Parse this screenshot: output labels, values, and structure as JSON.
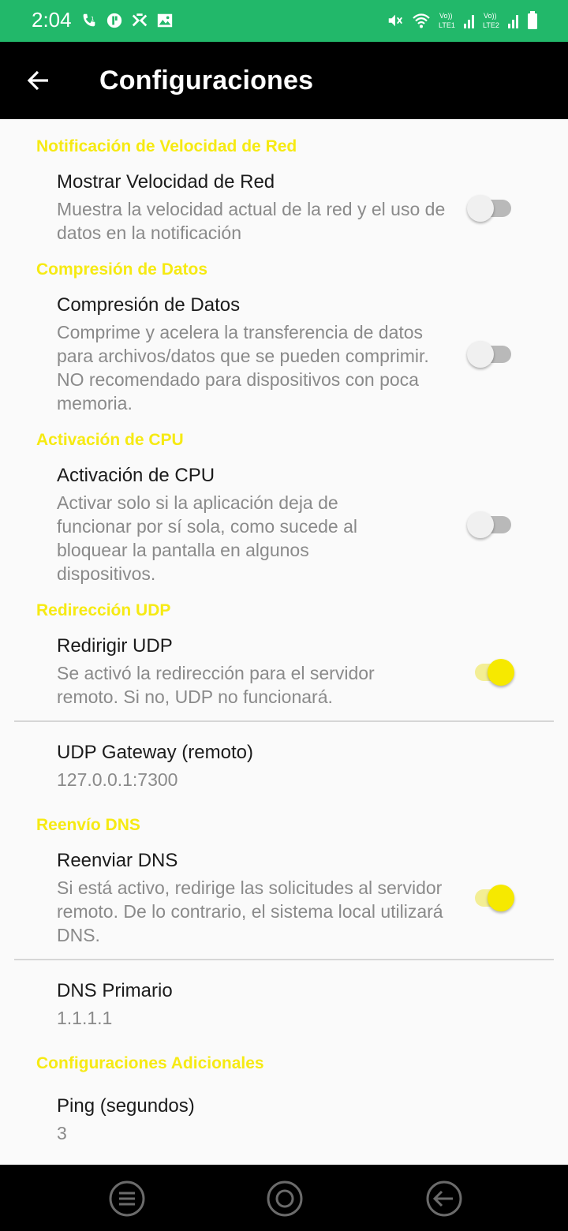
{
  "status_bar": {
    "time": "2:04",
    "background": "#22b86a",
    "left_icons": [
      "call-icon",
      "app-icon",
      "vpn-icon",
      "image-icon"
    ],
    "right_icons": [
      "mute-icon",
      "wifi-icon",
      "sim1-signal-icon",
      "sim2-signal-icon",
      "battery-icon"
    ],
    "sim1_label": "LTE1",
    "sim2_label": "LTE2",
    "volte_label": "Vo))"
  },
  "app_bar": {
    "title": "Configuraciones",
    "back_icon": "arrow-left-icon"
  },
  "colors": {
    "accent": "#f6ea13",
    "switch_on": "#f6e900",
    "appbar": "#000000"
  },
  "sections": {
    "network_speed": {
      "header": "Notificación de Velocidad de Red",
      "title": "Mostrar Velocidad de Red",
      "summary": "Muestra la velocidad actual de la red y el uso de datos en la notificación",
      "enabled": false
    },
    "compression": {
      "header": "Compresión de Datos",
      "title": "Compresión de Datos",
      "summary": "Comprime y acelera la transferencia de datos para archivos/datos que se pueden comprimir. NO recomendado para dispositivos con poca memoria.",
      "enabled": false
    },
    "cpu": {
      "header": "Activación de CPU",
      "title": "Activación de CPU",
      "summary": "Activar solo si la aplicación deja de funcionar por sí sola, como sucede al bloquear la pantalla en algunos dispositivos.",
      "enabled": false
    },
    "udp": {
      "header": "Redirección UDP",
      "title": "Redirigir UDP",
      "summary": "Se activó la redirección para el servidor remoto. Si no, UDP no funcionará.",
      "enabled": true,
      "gateway_title": "UDP Gateway (remoto)",
      "gateway_value": "127.0.0.1:7300"
    },
    "dns": {
      "header": "Reenvío DNS",
      "title": "Reenviar DNS",
      "summary": "Si está activo, redirige las solicitudes al servidor remoto. De lo contrario, el sistema local utilizará DNS.",
      "enabled": true,
      "primary_title": "DNS Primario",
      "primary_value": "1.1.1.1"
    },
    "additional": {
      "header": "Configuraciones Adicionales",
      "ping_title": "Ping (segundos)",
      "ping_value": "3"
    }
  },
  "nav_bar": {
    "icons": [
      "menu-icon",
      "home-icon",
      "back-icon"
    ]
  }
}
